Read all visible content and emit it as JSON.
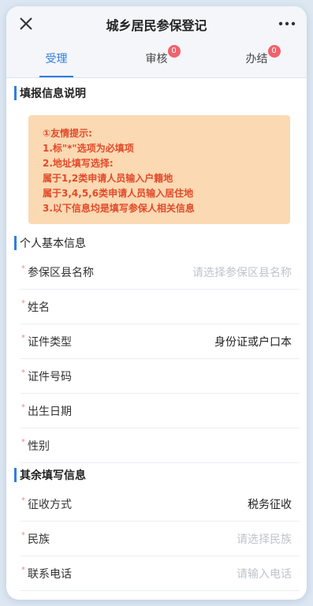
{
  "header": {
    "title": "城乡居民参保登记"
  },
  "tabs": [
    {
      "label": "受理",
      "badge": null
    },
    {
      "label": "审核",
      "badge": "0"
    },
    {
      "label": "办结",
      "badge": "0"
    }
  ],
  "sections": {
    "instructions": "填报信息说明",
    "basic": "个人基本信息",
    "other": "其余填写信息"
  },
  "notice": {
    "lines": [
      "①友情提示:",
      "1.标\"*\"选项为必填项",
      "2.地址填写选择:",
      "属于1,2类申请人员输入户籍地",
      "属于3,4,5,6类申请人员输入居住地",
      "3.以下信息均是填写参保人相关信息"
    ]
  },
  "required_mark": "*",
  "basic_fields": [
    {
      "label": "参保区县名称",
      "value": "",
      "placeholder": "请选择参保区县名称"
    },
    {
      "label": "姓名",
      "value": "",
      "placeholder": ""
    },
    {
      "label": "证件类型",
      "value": "身份证或户口本",
      "placeholder": ""
    },
    {
      "label": "证件号码",
      "value": "",
      "placeholder": ""
    },
    {
      "label": "出生日期",
      "value": "",
      "placeholder": ""
    },
    {
      "label": "性别",
      "value": "",
      "placeholder": ""
    }
  ],
  "other_fields": [
    {
      "label": "征收方式",
      "value": "税务征收",
      "placeholder": ""
    },
    {
      "label": "民族",
      "value": "",
      "placeholder": "请选择民族"
    },
    {
      "label": "联系电话",
      "value": "",
      "placeholder": "请输入电话"
    }
  ],
  "colors": {
    "accent": "#2f7de1",
    "notice_bg": "#fbd9b2",
    "notice_text": "#e24a2a",
    "badge": "#f0626c"
  }
}
